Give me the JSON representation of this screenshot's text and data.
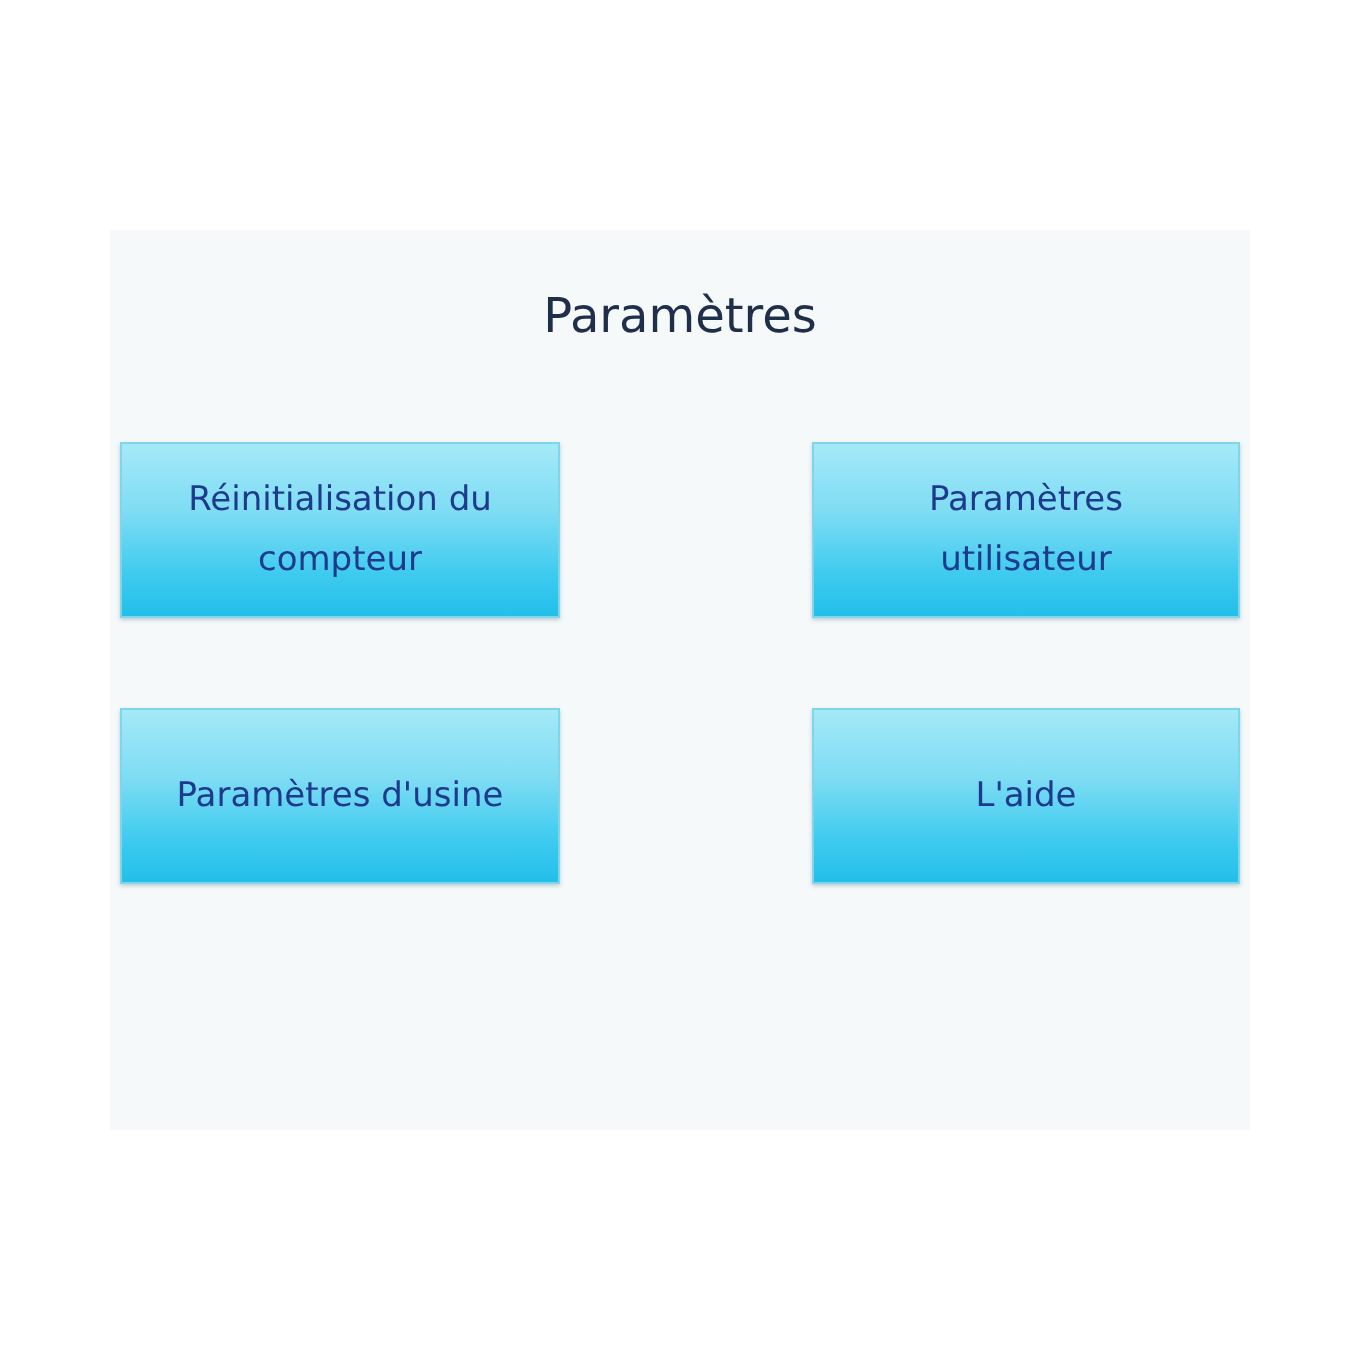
{
  "screen": {
    "title": "Paramètres"
  },
  "buttons": [
    {
      "label": "Réinitialisation du compteur"
    },
    {
      "label": "Paramètres utilisateur"
    },
    {
      "label": "Paramètres d'usine"
    },
    {
      "label": "L'aide"
    }
  ]
}
